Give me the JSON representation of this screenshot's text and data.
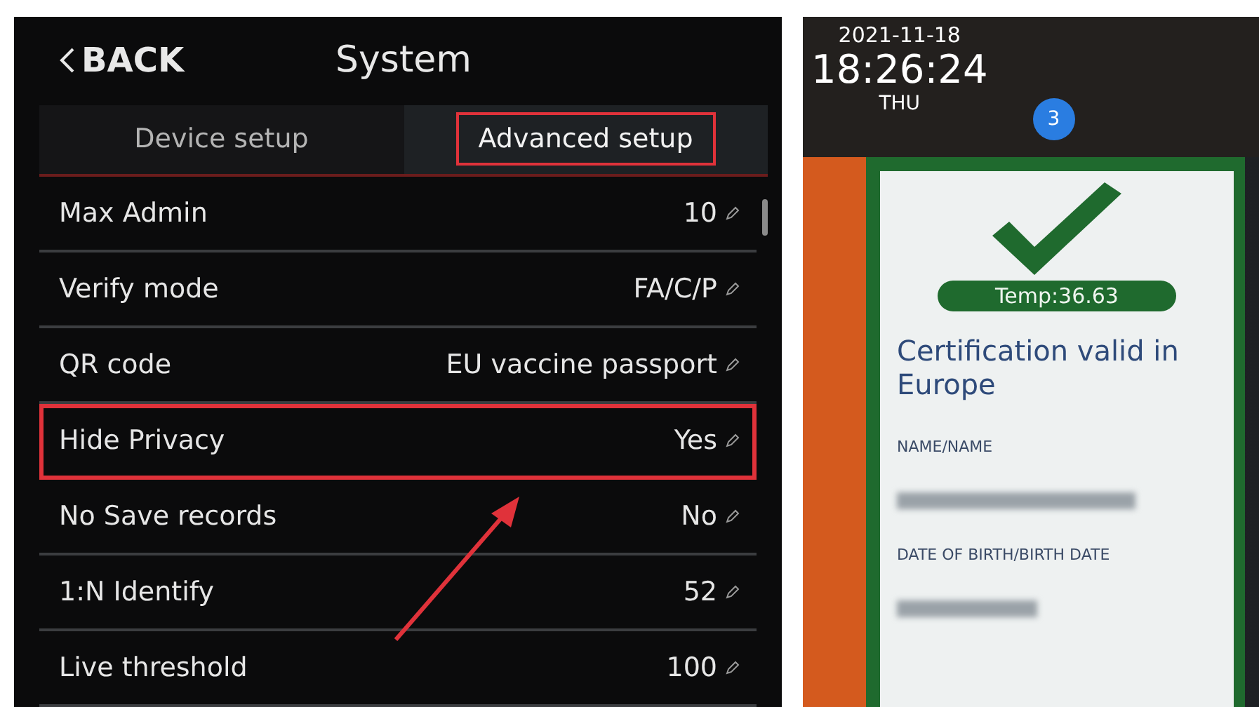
{
  "settings_screen": {
    "back_label": "BACK",
    "title": "System",
    "tabs": [
      {
        "label": "Device setup",
        "selected": false,
        "highlighted": false
      },
      {
        "label": "Advanced setup",
        "selected": true,
        "highlighted": true
      }
    ],
    "rows": [
      {
        "label": "Max Admin",
        "value": "10",
        "highlighted": false
      },
      {
        "label": "Verify mode",
        "value": "FA/C/P",
        "highlighted": false
      },
      {
        "label": "QR code",
        "value": "EU vaccine passport",
        "highlighted": false
      },
      {
        "label": "Hide Privacy",
        "value": "Yes",
        "highlighted": true
      },
      {
        "label": "No Save records",
        "value": "No",
        "highlighted": false
      },
      {
        "label": "1:N Identify",
        "value": "52",
        "highlighted": false
      },
      {
        "label": "Live threshold",
        "value": "100",
        "highlighted": false
      }
    ]
  },
  "verification_screen": {
    "date": "2021-11-18",
    "time": "18:26:24",
    "weekday": "THU",
    "badge": "3",
    "temperature": "Temp:36.63",
    "result": "Certification valid in Europe",
    "fields": [
      {
        "label": "NAME/NAME"
      },
      {
        "label": "DATE OF BIRTH/BIRTH DATE"
      }
    ]
  }
}
